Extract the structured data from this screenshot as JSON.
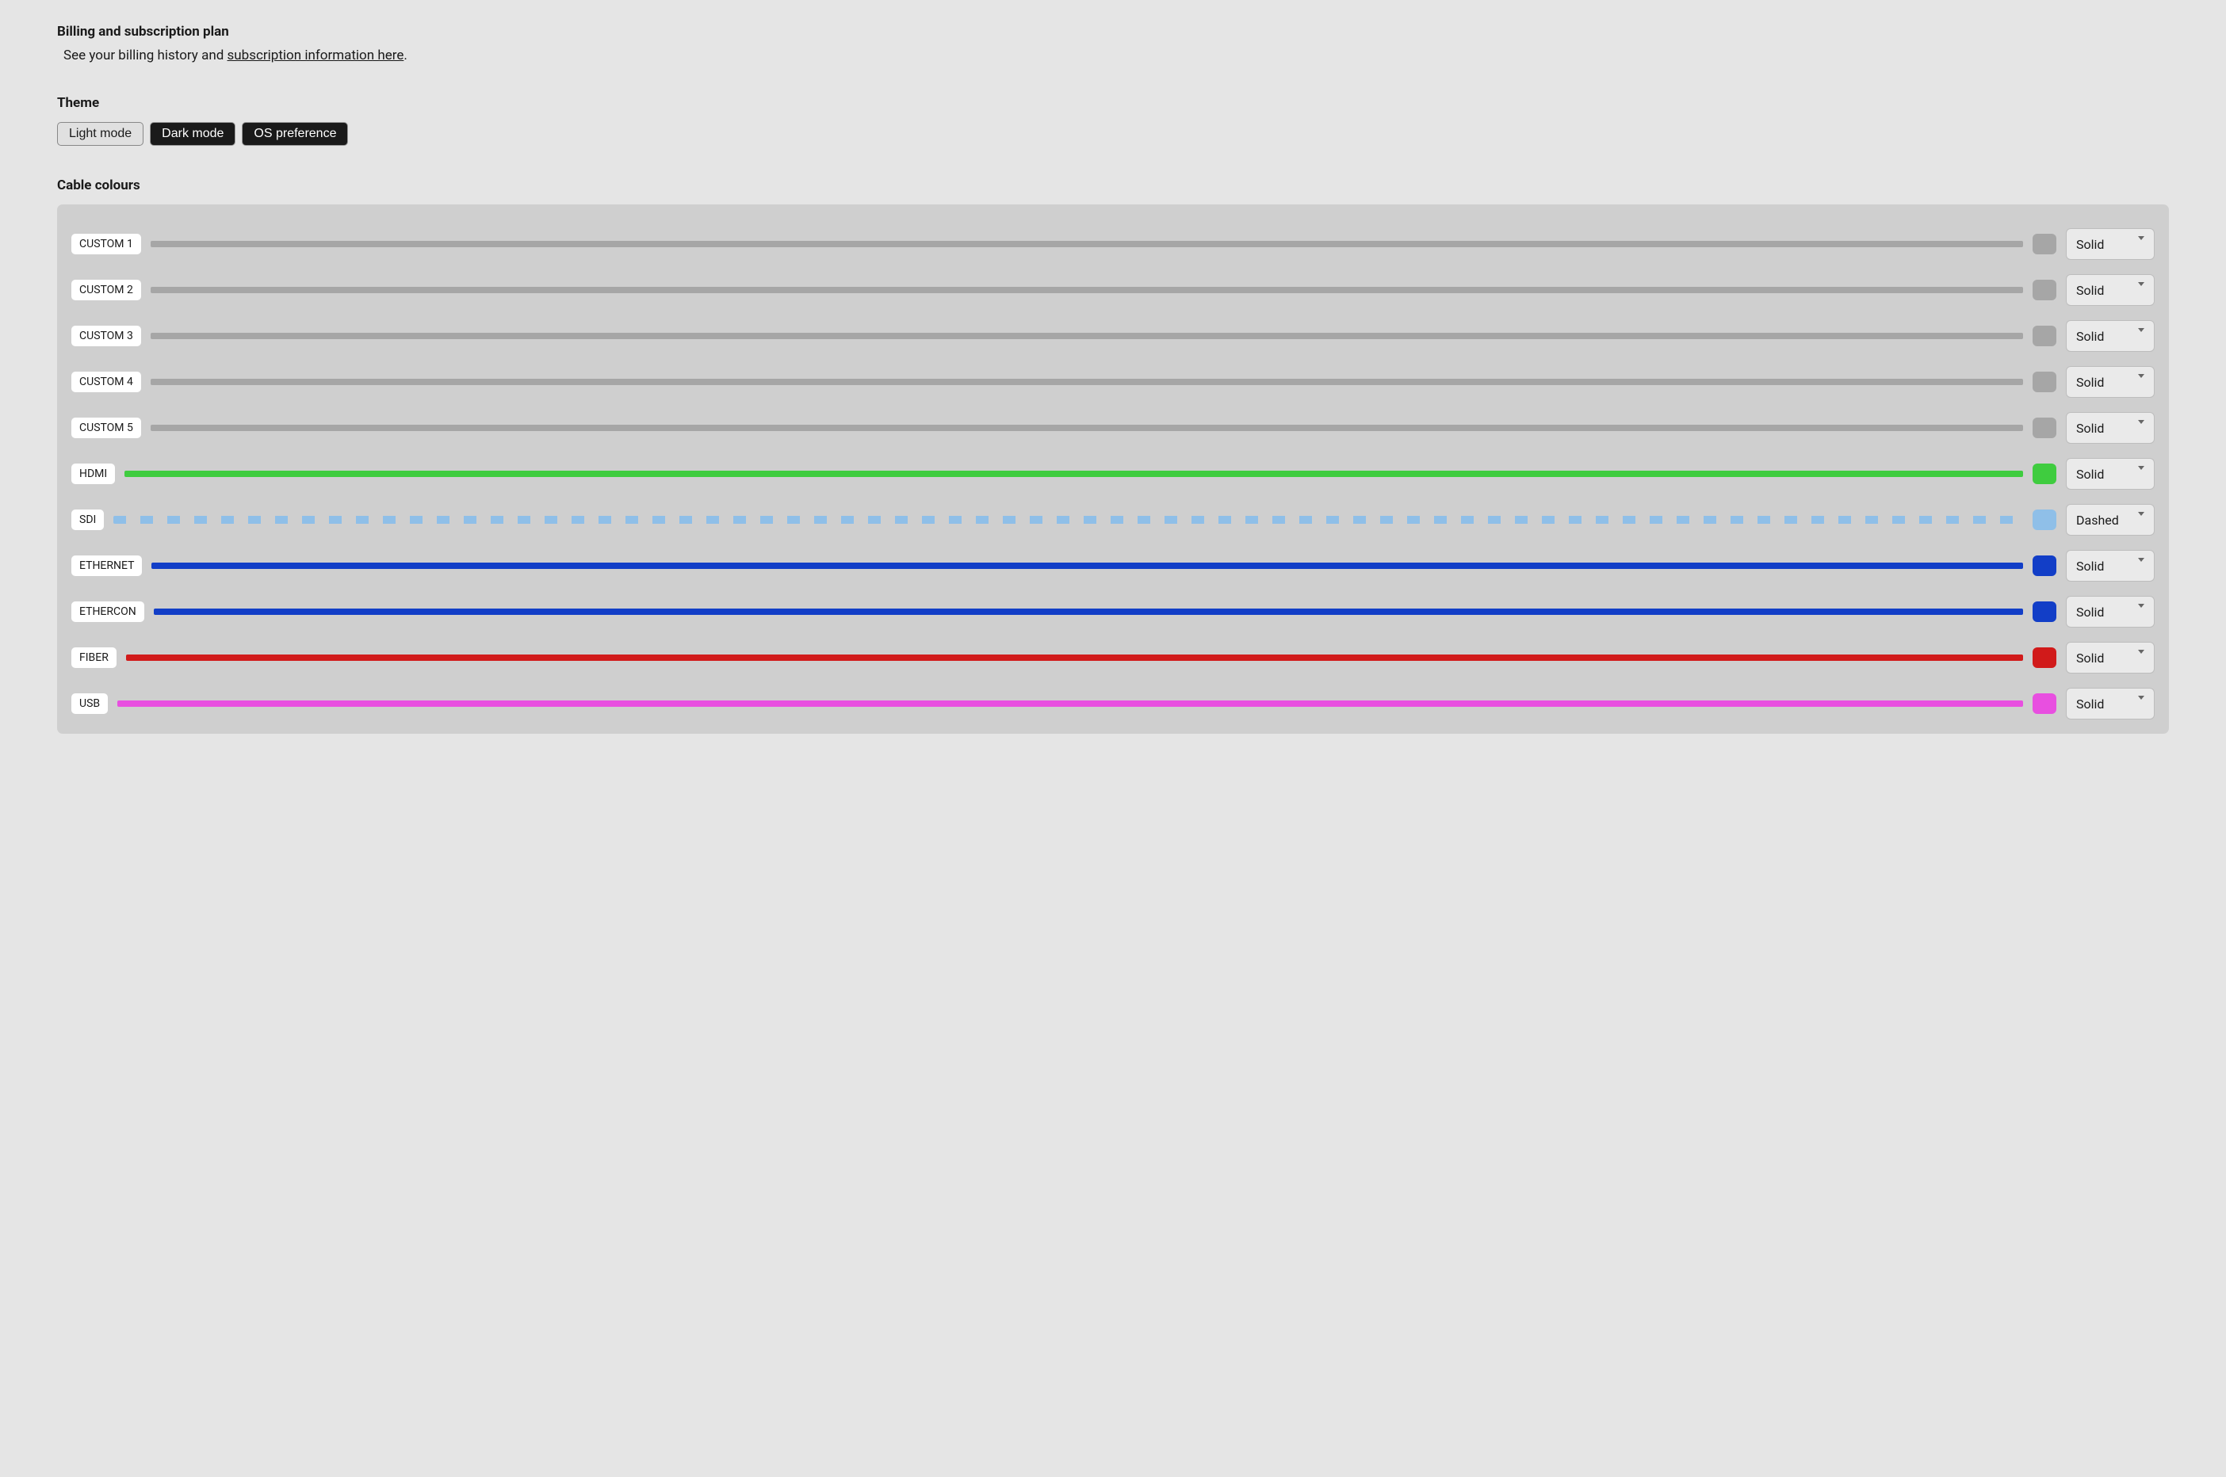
{
  "billing": {
    "title": "Billing and subscription plan",
    "text_prefix": "See your billing history and ",
    "link_text": "subscription information here",
    "text_suffix": "."
  },
  "theme": {
    "title": "Theme",
    "options": {
      "light": "Light mode",
      "dark": "Dark mode",
      "os": "OS preference"
    }
  },
  "cable_colours": {
    "title": "Cable colours",
    "rows": [
      {
        "label": "CUSTOM 1",
        "color": "#a6a6a6",
        "style": "Solid"
      },
      {
        "label": "CUSTOM 2",
        "color": "#a6a6a6",
        "style": "Solid"
      },
      {
        "label": "CUSTOM 3",
        "color": "#a6a6a6",
        "style": "Solid"
      },
      {
        "label": "CUSTOM 4",
        "color": "#a6a6a6",
        "style": "Solid"
      },
      {
        "label": "CUSTOM 5",
        "color": "#a6a6a6",
        "style": "Solid"
      },
      {
        "label": "HDMI",
        "color": "#3fcc3f",
        "style": "Solid"
      },
      {
        "label": "SDI",
        "color": "#8fbfe8",
        "style": "Dashed"
      },
      {
        "label": "ETHERNET",
        "color": "#123ec7",
        "style": "Solid"
      },
      {
        "label": "ETHERCON",
        "color": "#123ec7",
        "style": "Solid"
      },
      {
        "label": "FIBER",
        "color": "#d11a1a",
        "style": "Solid"
      },
      {
        "label": "USB",
        "color": "#e84fe0",
        "style": "Solid"
      }
    ]
  }
}
